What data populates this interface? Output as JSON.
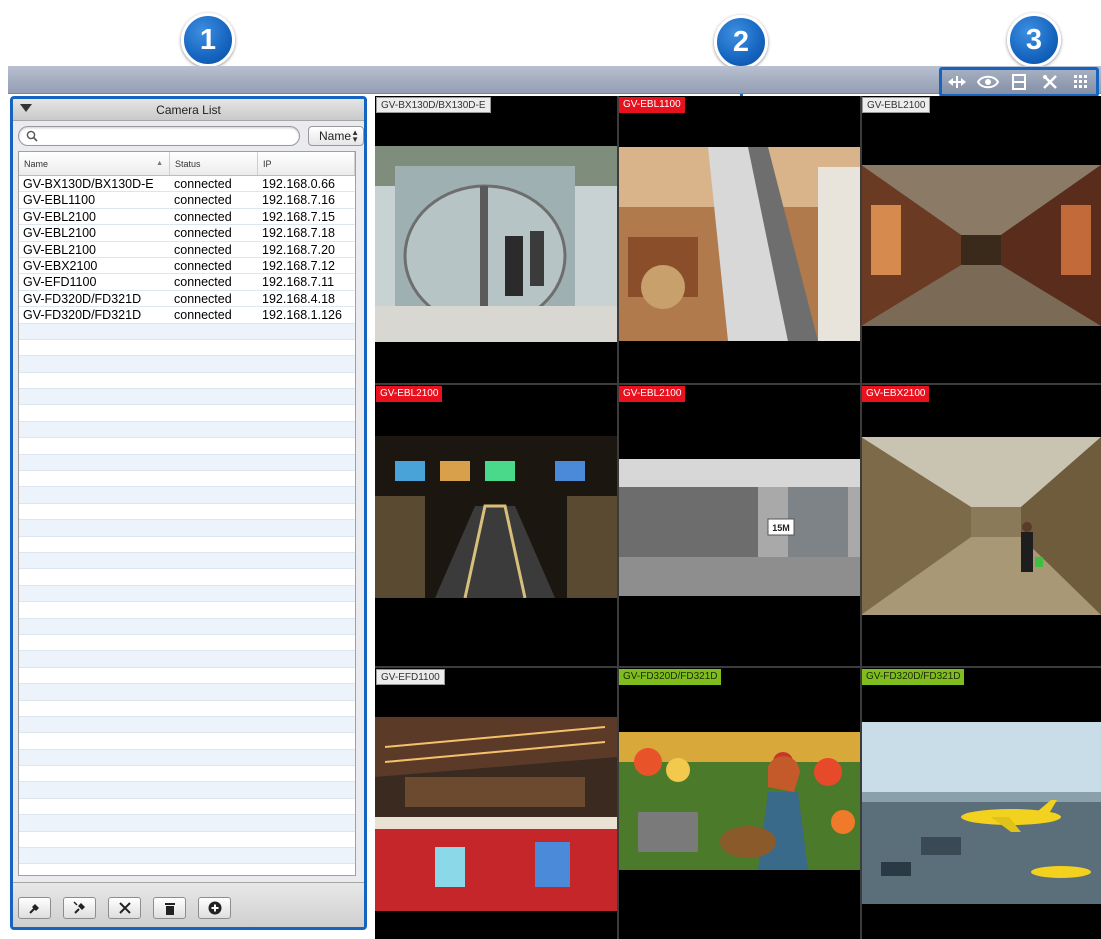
{
  "callouts": [
    {
      "number": "1"
    },
    {
      "number": "2"
    },
    {
      "number": "3"
    }
  ],
  "toolbar": {
    "buttons": [
      {
        "icon": "resize-arrows-icon"
      },
      {
        "icon": "eye-icon"
      },
      {
        "icon": "film-strip-icon"
      },
      {
        "icon": "tools-icon"
      },
      {
        "icon": "grid-layout-icon"
      }
    ]
  },
  "camera_list": {
    "title": "Camera List",
    "search": {
      "value": "",
      "placeholder": ""
    },
    "sort_option": "Name",
    "columns": [
      "Name",
      "Status",
      "IP"
    ],
    "rows": [
      {
        "name": "GV-BX130D/BX130D-E",
        "status": "connected",
        "ip": "192.168.0.66"
      },
      {
        "name": "GV-EBL1100",
        "status": "connected",
        "ip": "192.168.7.16"
      },
      {
        "name": "GV-EBL2100",
        "status": "connected",
        "ip": "192.168.7.15"
      },
      {
        "name": "GV-EBL2100",
        "status": "connected",
        "ip": "192.168.7.18"
      },
      {
        "name": "GV-EBL2100",
        "status": "connected",
        "ip": "192.168.7.20"
      },
      {
        "name": "GV-EBX2100",
        "status": "connected",
        "ip": "192.168.7.12"
      },
      {
        "name": "GV-EFD1100",
        "status": "connected",
        "ip": "192.168.7.11"
      },
      {
        "name": "GV-FD320D/FD321D",
        "status": "connected",
        "ip": "192.168.4.18"
      },
      {
        "name": "GV-FD320D/FD321D",
        "status": "connected",
        "ip": "192.168.1.126"
      }
    ],
    "footer_buttons": [
      {
        "icon": "connect-icon"
      },
      {
        "icon": "disconnect-icon"
      },
      {
        "icon": "settings-tools-icon"
      },
      {
        "icon": "trash-icon"
      },
      {
        "icon": "add-icon"
      }
    ]
  },
  "video_tiles": [
    {
      "label": "GV-BX130D/BX130D-E",
      "label_color": "gray",
      "scene": "revolving glass door lobby"
    },
    {
      "label": "GV-EBL1100",
      "label_color": "red",
      "scene": "mall escalators from above"
    },
    {
      "label": "GV-EBL2100",
      "label_color": "gray",
      "scene": "shopping arcade corridor"
    },
    {
      "label": "GV-EBL2100",
      "label_color": "red",
      "scene": "airport escalators with screens"
    },
    {
      "label": "GV-EBL2100",
      "label_color": "red",
      "scene": "office room with door",
      "sign_text": "15M"
    },
    {
      "label": "GV-EBX2100",
      "label_color": "red",
      "scene": "hotel hallway with person"
    },
    {
      "label": "GV-EFD1100",
      "label_color": "gray",
      "scene": "cinema snack counter"
    },
    {
      "label": "GV-FD320D/FD321D",
      "label_color": "green",
      "scene": "woman in grocery store"
    },
    {
      "label": "GV-FD320D/FD321D",
      "label_color": "green",
      "scene": "airport apron with airplane"
    }
  ],
  "colors": {
    "callout_blue": "#1565c0",
    "label_red": "#e8111e",
    "label_green": "#7fbd1e",
    "label_gray": "#ececec"
  }
}
